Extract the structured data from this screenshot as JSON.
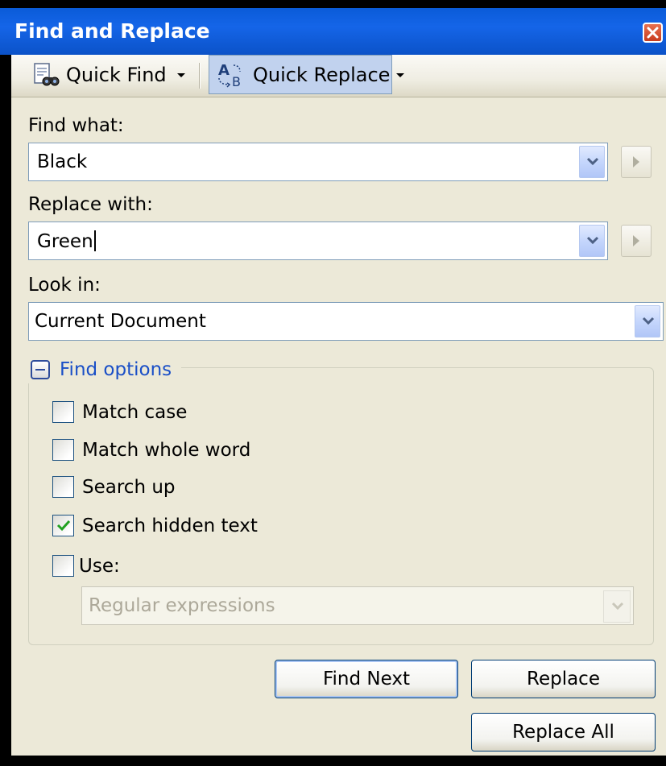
{
  "window": {
    "title": "Find and Replace",
    "title_color": "#ffffff",
    "titlebar_color": "#0a5bd8"
  },
  "toolbar": {
    "quick_find_label": "Quick Find",
    "quick_replace_label": "Quick Replace",
    "quick_replace_selected": true
  },
  "find": {
    "label": "Find what:",
    "value": "Black"
  },
  "replace": {
    "label": "Replace with:",
    "value": "Green"
  },
  "look_in": {
    "label": "Look in:",
    "value": "Current Document"
  },
  "options": {
    "title": "Find options",
    "expanded": true,
    "items": [
      {
        "label": "Match case",
        "checked": false
      },
      {
        "label": "Match whole word",
        "checked": false
      },
      {
        "label": "Search up",
        "checked": false
      },
      {
        "label": "Search hidden text",
        "checked": true
      },
      {
        "label": "Use:",
        "checked": false
      }
    ],
    "use_type": {
      "value": "Regular expressions",
      "enabled": false
    }
  },
  "buttons": {
    "find_next": "Find Next",
    "replace": "Replace",
    "replace_all": "Replace All"
  },
  "colors": {
    "dialog_bg": "#ece9d8",
    "link_blue": "#1a4fc7",
    "check_green": "#21a121",
    "disabled_text": "#aca899"
  }
}
